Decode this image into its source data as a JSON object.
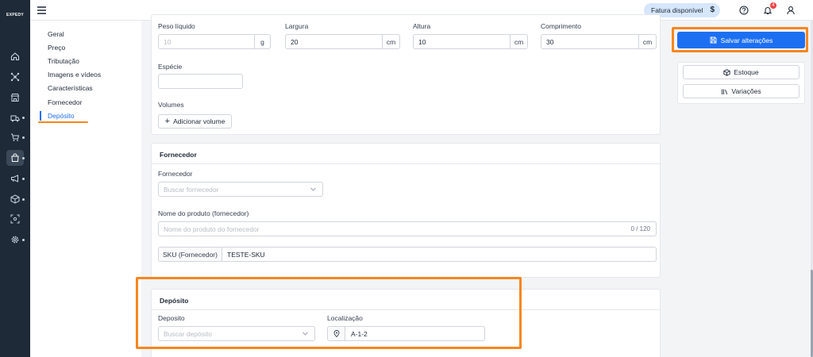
{
  "brand": {
    "logo": "EXPEDY"
  },
  "topbar": {
    "fatura_label": "Fatura disponível",
    "fatura_icon": "dollar-icon",
    "notifications_count": "4"
  },
  "nav": {
    "items": [
      {
        "label": "Geral"
      },
      {
        "label": "Preço"
      },
      {
        "label": "Tributação"
      },
      {
        "label": "Imagens e vídeos"
      },
      {
        "label": "Características"
      },
      {
        "label": "Fornecedor"
      },
      {
        "label": "Depósito"
      }
    ],
    "active": "Depósito"
  },
  "dimensions": {
    "peso_label": "Peso líquido",
    "peso_placeholder": "10",
    "peso_unit": "g",
    "largura_label": "Largura",
    "largura_value": "20",
    "largura_unit": "cm",
    "altura_label": "Altura",
    "altura_value": "10",
    "altura_unit": "cm",
    "comprimento_label": "Comprimento",
    "comprimento_value": "30",
    "comprimento_unit": "cm",
    "especie_label": "Espécie",
    "especie_value": "",
    "volumes_label": "Volumes",
    "add_volume_label": "Adicionar volume"
  },
  "fornecedor": {
    "title": "Fornecedor",
    "fornecedor_label": "Fornecedor",
    "fornecedor_placeholder": "Buscar fornecedor",
    "nome_label": "Nome do produto (fornecedor)",
    "nome_placeholder": "Nome do produto do fornecedor",
    "nome_counter": "0 / 120",
    "sku_addon": "SKU (Fornecedor)",
    "sku_value": "TESTE-SKU"
  },
  "deposito": {
    "title": "Depósito",
    "deposito_label": "Deposito",
    "deposito_placeholder": "Buscar depósito",
    "localizacao_label": "Localização",
    "localizacao_value": "A-1-2"
  },
  "actions": {
    "save_label": "Salvar alterações",
    "estoque_label": "Estoque",
    "variacoes_label": "Variações"
  },
  "colors": {
    "accent": "#1d6ff2",
    "highlight": "#f7861e",
    "rail": "#1e2a38",
    "badge": "#ef4444"
  }
}
